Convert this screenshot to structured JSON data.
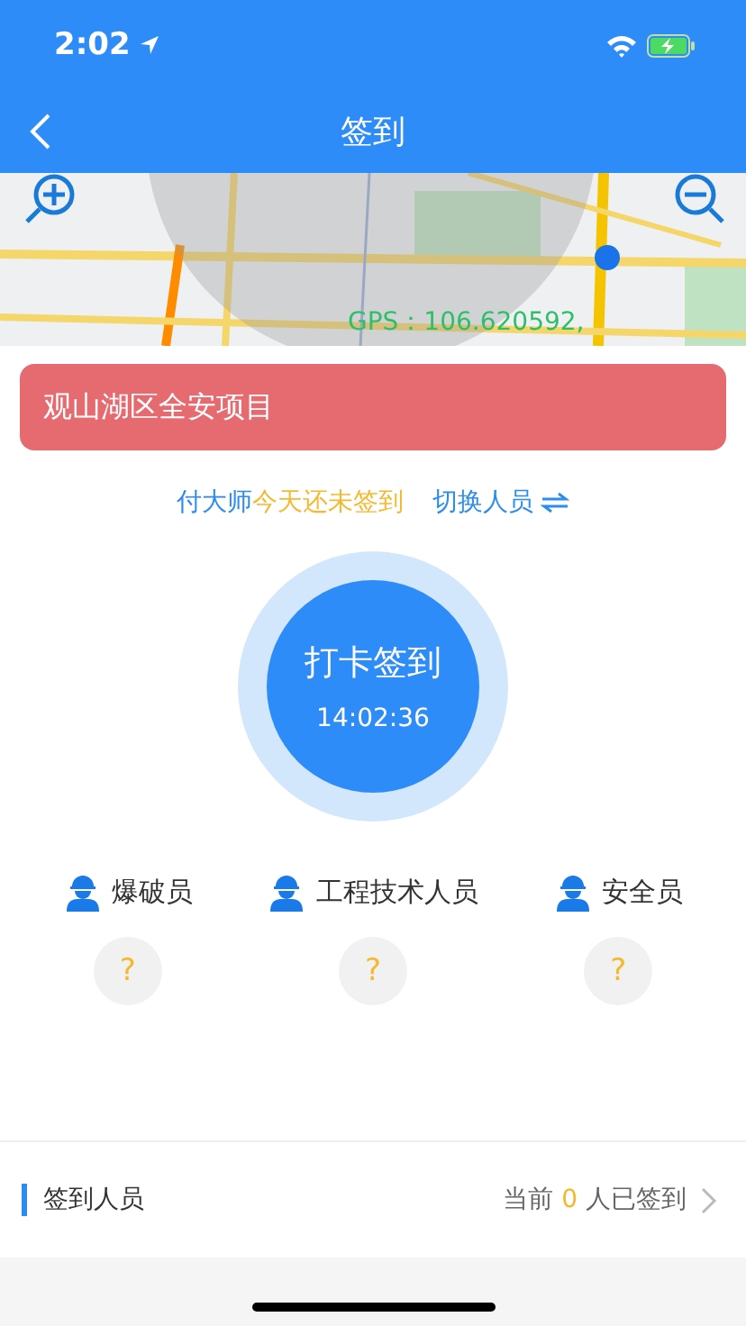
{
  "status_bar": {
    "time": "2:02"
  },
  "nav": {
    "title": "签到"
  },
  "map": {
    "kind": "picture",
    "gps": "GPS：106.620592,"
  },
  "project": {
    "name": "观山湖区全安项目"
  },
  "sign_status": {
    "person": "付大师",
    "status": "今天还未签到",
    "switch_label": "切换人员"
  },
  "punch": {
    "label": "打卡签到",
    "time": "14:02:36"
  },
  "roles": [
    {
      "name": "爆破员",
      "mark": "?"
    },
    {
      "name": "工程技术人员",
      "mark": "?"
    },
    {
      "name": "安全员",
      "mark": "?"
    }
  ],
  "footer": {
    "title": "签到人员",
    "count_prefix": "当前",
    "count": "0",
    "count_suffix": "人已签到"
  }
}
